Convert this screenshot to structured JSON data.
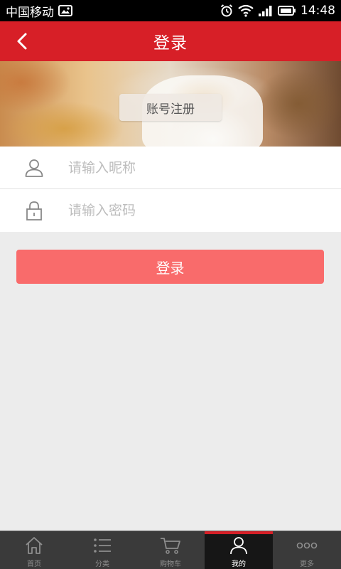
{
  "status_bar": {
    "carrier": "中国移动",
    "time": "14:48"
  },
  "header": {
    "title": "登录"
  },
  "banner": {
    "register_label": "账号注册"
  },
  "form": {
    "nickname_placeholder": "请输入昵称",
    "password_placeholder": "请输入密码"
  },
  "login_button": {
    "label": "登录"
  },
  "tab_bar": {
    "tabs": [
      {
        "label": "首页",
        "icon": "home-icon"
      },
      {
        "label": "分类",
        "icon": "list-icon"
      },
      {
        "label": "购物车",
        "icon": "cart-icon"
      },
      {
        "label": "我的",
        "icon": "user-icon",
        "active": true
      },
      {
        "label": "更多",
        "icon": "more-icon"
      }
    ]
  },
  "colors": {
    "brand_red": "#d71f27",
    "login_button": "#f96b6b",
    "background": "#ececec",
    "tab_bar": "#3a3a3a"
  }
}
